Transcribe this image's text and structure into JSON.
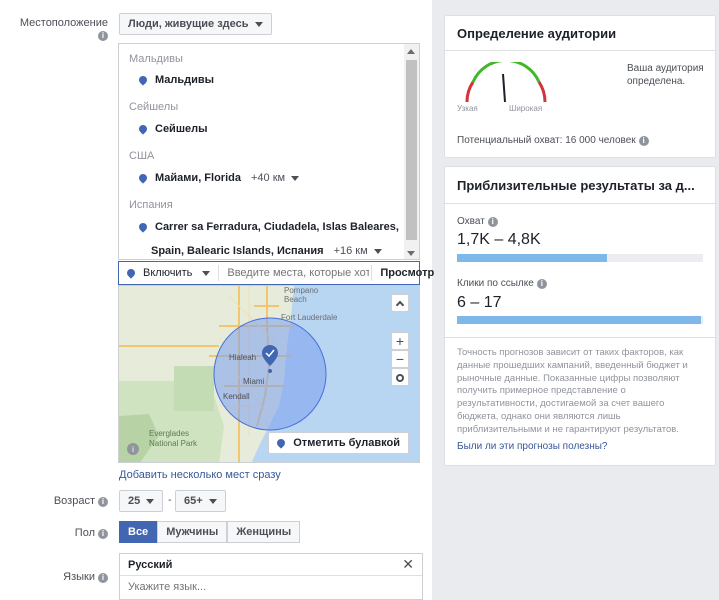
{
  "location": {
    "label": "Местоположение",
    "mode_select": "Люди, живущие здесь",
    "groups": [
      {
        "country": "Мальдивы",
        "place": "Мальдивы",
        "radius": ""
      },
      {
        "country": "Сейшелы",
        "place": "Сейшелы",
        "radius": ""
      },
      {
        "country": "США",
        "place": "Майами, Florida",
        "radius": "+40 км"
      },
      {
        "country": "Испания",
        "place": "Carrer sa Ferradura, Ciudadela, Islas Baleares,",
        "place_line2": "Spain, Balearic Islands, Испания",
        "radius": "+16 км"
      }
    ],
    "include_label": "Включить",
    "search_placeholder": "Введите места, которые хотите",
    "browse": "Просмотр",
    "drop_pin": "Отметить булавкой",
    "add_bulk": "Добавить несколько мест сразу",
    "map_labels": {
      "pompano": "Pompano",
      "beach": "Beach",
      "fortl": "Fort Lauderdale",
      "hialeah": "Hialeah",
      "miami": "Miami",
      "kendall": "Kendall",
      "everglades": "Everglades",
      "national": "National Park"
    }
  },
  "age": {
    "label": "Возраст",
    "from": "25",
    "dash": "-",
    "to": "65+"
  },
  "gender": {
    "label": "Пол",
    "options": [
      "Все",
      "Мужчины",
      "Женщины"
    ],
    "selected": "Все"
  },
  "languages": {
    "label": "Языки",
    "selected": "Русский",
    "placeholder": "Укажите язык..."
  },
  "audience_card": {
    "title": "Определение аудитории",
    "narrow": "Узкая",
    "wide": "Широкая",
    "status": "Ваша аудитория определена.",
    "reach": "Потенциальный охват: 16 000 человек"
  },
  "results_card": {
    "title": "Приблизительные результаты за д...",
    "reach_label": "Охват",
    "reach_value": "1,7K – 4,8K",
    "reach_fill": 0.61,
    "clicks_label": "Клики по ссылке",
    "clicks_value": "6 – 17",
    "clicks_fill": 0.99,
    "disclaimer": "Точность прогнозов зависит от таких факторов, как данные прошедших кампаний, введенный бюджет и рыночные данные. Показанные цифры позволяют получить примерное представление о результативности, достигаемой за счет вашего бюджета, однако они являются лишь приблизительными и не гарантируют результатов.",
    "feedback_link": "Были ли эти прогнозы полезны?"
  },
  "colors": {
    "accent": "#4267b2",
    "bar": "#7eb8e9",
    "gauge_red": "#d0353b",
    "gauge_green": "#42b72a"
  }
}
